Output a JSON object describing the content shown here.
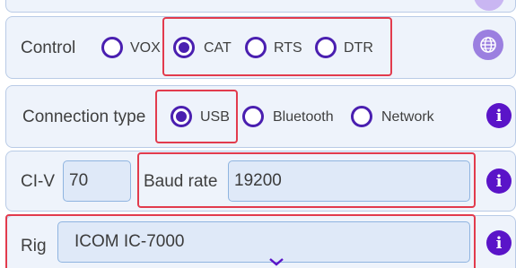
{
  "control": {
    "label": "Control",
    "options": [
      {
        "label": "VOX",
        "selected": false
      },
      {
        "label": "CAT",
        "selected": true
      },
      {
        "label": "RTS",
        "selected": false
      },
      {
        "label": "DTR",
        "selected": false
      }
    ]
  },
  "connection": {
    "label": "Connection type",
    "options": [
      {
        "label": "USB",
        "selected": true
      },
      {
        "label": "Bluetooth",
        "selected": false
      },
      {
        "label": "Network",
        "selected": false
      }
    ]
  },
  "civ": {
    "label": "CI-V",
    "value": "70",
    "baud_label": "Baud rate",
    "baud_value": "19200"
  },
  "rig": {
    "label": "Rig",
    "value": "ICOM IC-7000"
  },
  "info_glyph": "i",
  "colors": {
    "accent": "#4a1fb0",
    "highlight": "#e23b4d",
    "panel_bg": "#eef3fb",
    "info_button": "#5a14c8"
  }
}
